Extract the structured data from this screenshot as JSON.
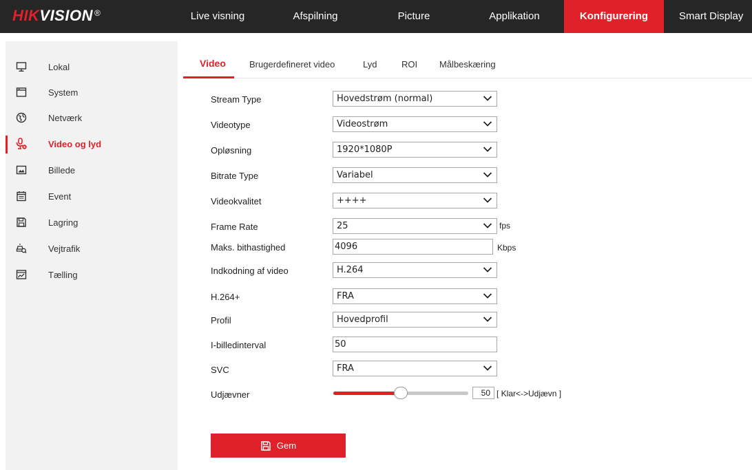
{
  "brand": {
    "logo_red": "HIK",
    "logo_white": "VISION",
    "logo_reg": "®"
  },
  "nav": {
    "items": [
      {
        "label": "Live visning"
      },
      {
        "label": "Afspilning"
      },
      {
        "label": "Picture"
      },
      {
        "label": "Applikation"
      },
      {
        "label": "Konfigurering",
        "active": true
      },
      {
        "label": "Smart Display"
      }
    ]
  },
  "sidebar": {
    "items": [
      {
        "label": "Lokal",
        "icon": "monitor-icon"
      },
      {
        "label": "System",
        "icon": "window-icon"
      },
      {
        "label": "Netværk",
        "icon": "globe-icon"
      },
      {
        "label": "Video og lyd",
        "icon": "mic-icon",
        "active": true
      },
      {
        "label": "Billede",
        "icon": "image-icon"
      },
      {
        "label": "Event",
        "icon": "calendar-icon"
      },
      {
        "label": "Lagring",
        "icon": "save-icon"
      },
      {
        "label": "Vejtrafik",
        "icon": "car-search-icon"
      },
      {
        "label": "Tælling",
        "icon": "chart-icon"
      }
    ]
  },
  "tabs": [
    {
      "label": "Video",
      "active": true
    },
    {
      "label": "Brugerdefineret video"
    },
    {
      "label": "Lyd"
    },
    {
      "label": "ROI"
    },
    {
      "label": "Målbeskæring"
    }
  ],
  "form": {
    "stream_type": {
      "label": "Stream Type",
      "value": "Hovedstrøm (normal)"
    },
    "video_type": {
      "label": "Videotype",
      "value": "Videostrøm"
    },
    "resolution": {
      "label": "Opløsning",
      "value": "1920*1080P"
    },
    "bitrate_type": {
      "label": "Bitrate Type",
      "value": "Variabel"
    },
    "video_quality": {
      "label": "Videokvalitet",
      "value": "++++"
    },
    "frame_rate": {
      "label": "Frame Rate",
      "value": "25",
      "unit": "fps"
    },
    "max_bitrate": {
      "label": "Maks. bithastighed",
      "value": "4096",
      "unit": "Kbps"
    },
    "video_encoding": {
      "label": "Indkodning af video",
      "value": "H.264"
    },
    "h264plus": {
      "label": "H.264+",
      "value": "FRA"
    },
    "profile": {
      "label": "Profil",
      "value": "Hovedprofil"
    },
    "i_frame_interval": {
      "label": "I-billedinterval",
      "value": "50"
    },
    "svc": {
      "label": "SVC",
      "value": "FRA"
    },
    "smoothing": {
      "label": "Udjævner",
      "value": "50",
      "hint": "[ Klar<->Udjævn ]",
      "level_percent": 50
    }
  },
  "save_button": {
    "label": "Gem",
    "icon": "save-icon"
  },
  "colors": {
    "accent": "#e0212a",
    "topbar": "#262626",
    "sidebar_bg": "#f2f2f2"
  }
}
